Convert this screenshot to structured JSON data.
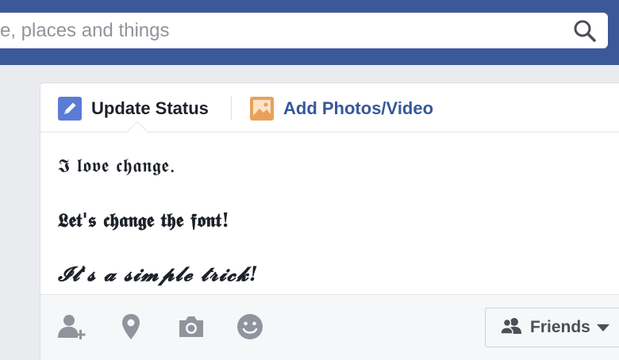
{
  "search": {
    "placeholder": "e, places and things"
  },
  "composer_tabs": [
    {
      "label": "Update Status",
      "icon": "pencil-icon"
    },
    {
      "label": "Add Photos/Video",
      "icon": "photo-icon"
    }
  ],
  "composer": {
    "lines": [
      "𝕴 𝖑𝖔𝖛𝖊 𝖈𝖍𝖆𝖓𝖌𝖊.",
      "𝕷𝖊𝖙'𝖘 𝖈𝖍𝖆𝖓𝖌𝖊 𝖙𝖍𝖊 𝖋𝖔𝖓𝖙!",
      "𝓘𝓽'𝓼 𝓪 𝓼𝓲𝓶𝓹𝓵𝓮 𝓽𝓻𝓲𝓬𝓴!"
    ]
  },
  "footer": {
    "icons": [
      "tag-friends-icon",
      "location-icon",
      "camera-icon",
      "emoji-icon"
    ],
    "audience_label": "Friends"
  },
  "colors": {
    "brand": "#3b5998",
    "link": "#365899",
    "icon_gray": "#90949c"
  }
}
